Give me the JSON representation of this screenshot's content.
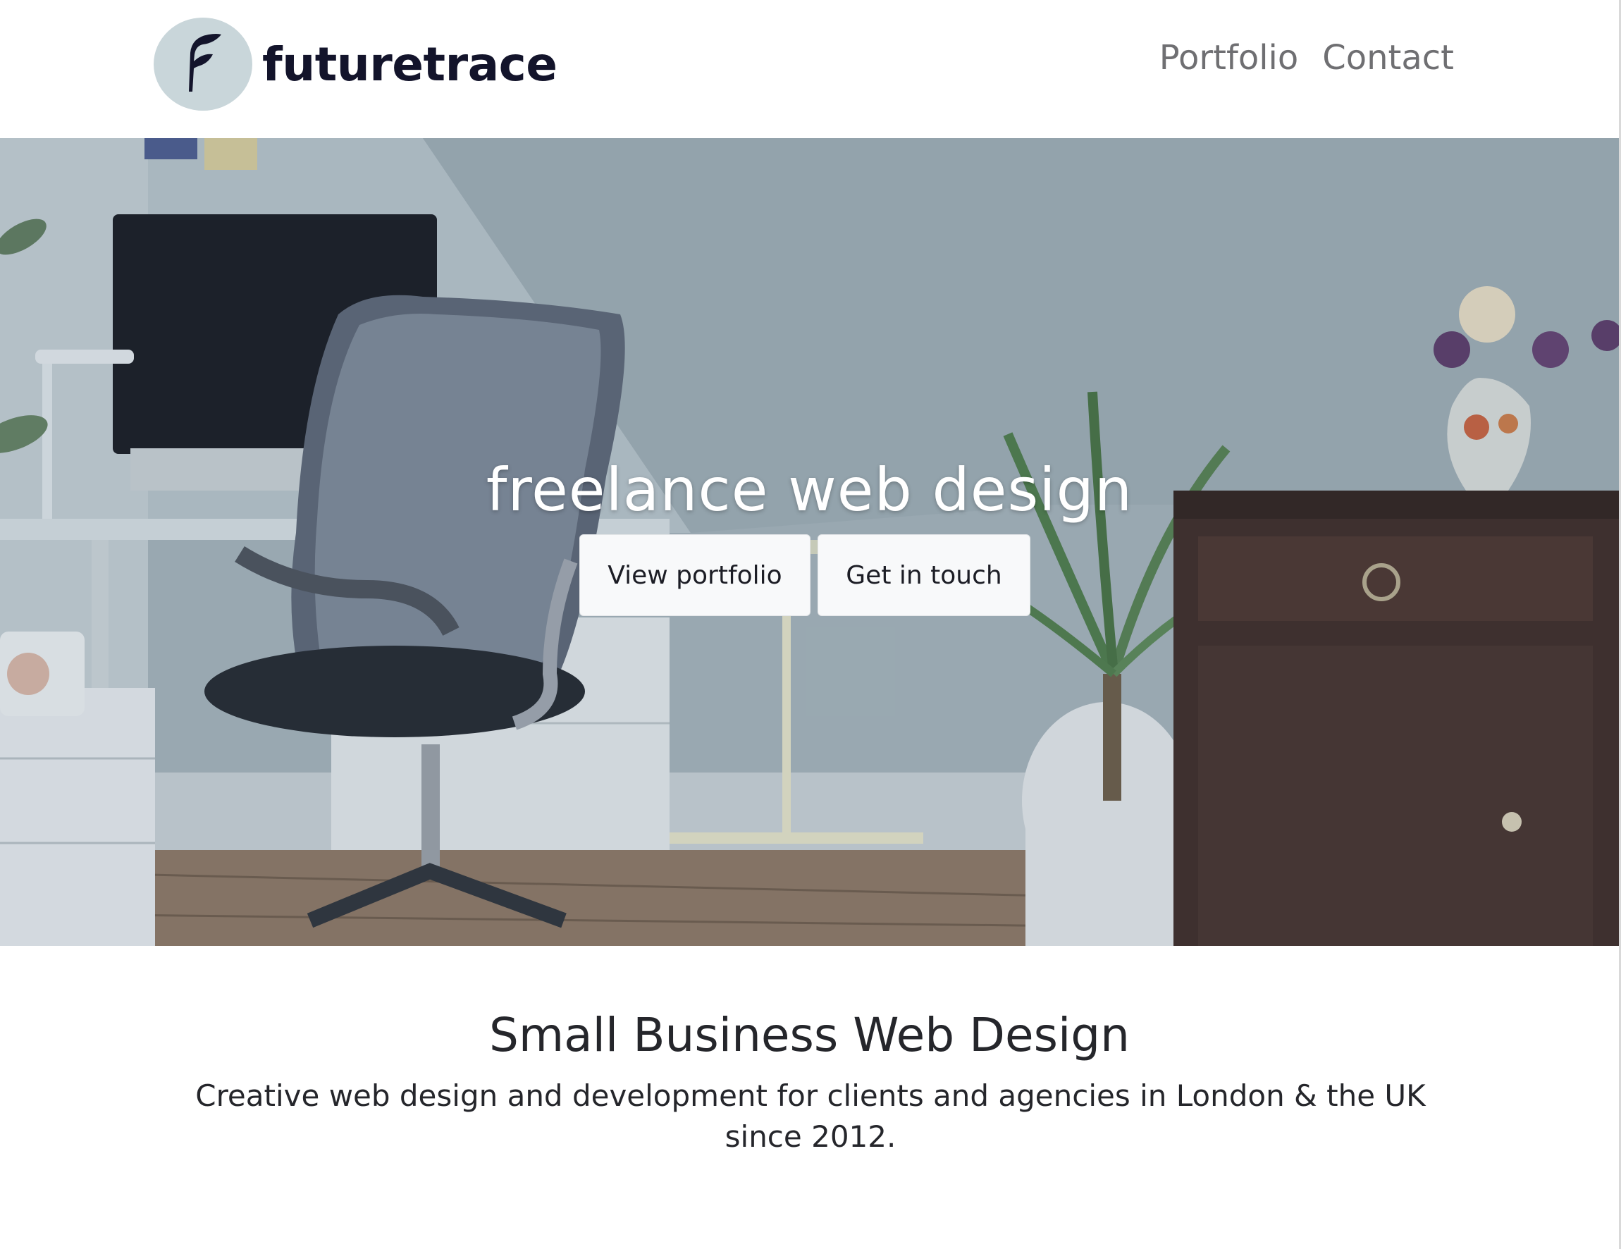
{
  "header": {
    "brand_name": "futuretrace",
    "nav": [
      {
        "label": "Portfolio"
      },
      {
        "label": "Contact"
      }
    ]
  },
  "hero": {
    "title": "freelance web design",
    "buttons": {
      "portfolio_label": "View portfolio",
      "contact_label": "Get in touch"
    }
  },
  "intro": {
    "heading": "Small Business Web Design",
    "text": "Creative web design and development for clients and agencies in London & the UK since 2012."
  },
  "colors": {
    "brand_text": "#13142b",
    "logo_circle": "#c9d6da",
    "nav_text": "#6f6f72",
    "button_bg": "#f8f9fa"
  }
}
